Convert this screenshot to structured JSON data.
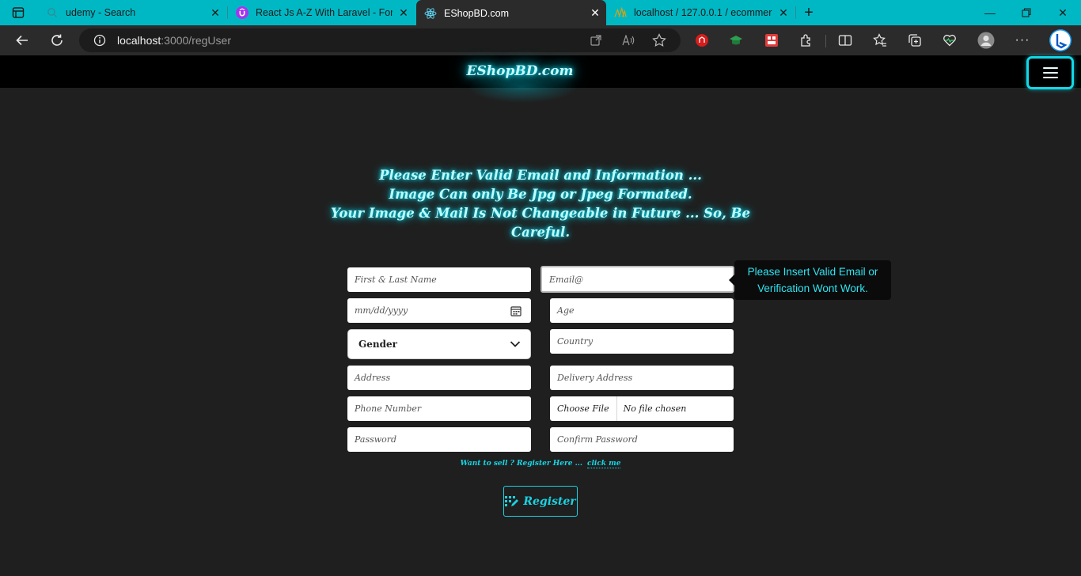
{
  "browser": {
    "tabs": [
      {
        "title": "udemy - Search",
        "icon": "search-icon"
      },
      {
        "title": "React Js A-Z With Laravel - For Be",
        "icon": "udemy-icon"
      },
      {
        "title": "EShopBD.com",
        "icon": "react-icon",
        "active": true
      },
      {
        "title": "localhost / 127.0.0.1 / ecommerce",
        "icon": "phpmyadmin-icon"
      }
    ],
    "url_host": "localhost",
    "url_path": ":3000/regUser",
    "accent": "#00b8c4"
  },
  "site": {
    "brand": "EShopBD.com",
    "notice": [
      "Please Enter Valid Email and Information ...",
      "Image Can only Be Jpg or Jpeg Formated.",
      "Your Image & Mail Is Not Changeable in Future ... So, Be Careful."
    ],
    "accent": "#12d8e8"
  },
  "form": {
    "name_ph": "First & Last Name",
    "email_ph": "Email@",
    "date_ph": "mm/dd/yyyy",
    "age_ph": "Age",
    "gender": "Gender",
    "country_ph": "Country",
    "address_ph": "Address",
    "delivery_ph": "Delivery Address",
    "phone_ph": "Phone Number",
    "file_button": "Choose File",
    "file_status": "No file chosen",
    "password_ph": "Password",
    "confirm_ph": "Confirm Password",
    "email_tooltip_1": "Please Insert Valid Email or",
    "email_tooltip_2": "Verification Wont Work.",
    "seller_text": "Want to sell ? Register Here ...",
    "seller_link": "click me",
    "register": "Register"
  }
}
